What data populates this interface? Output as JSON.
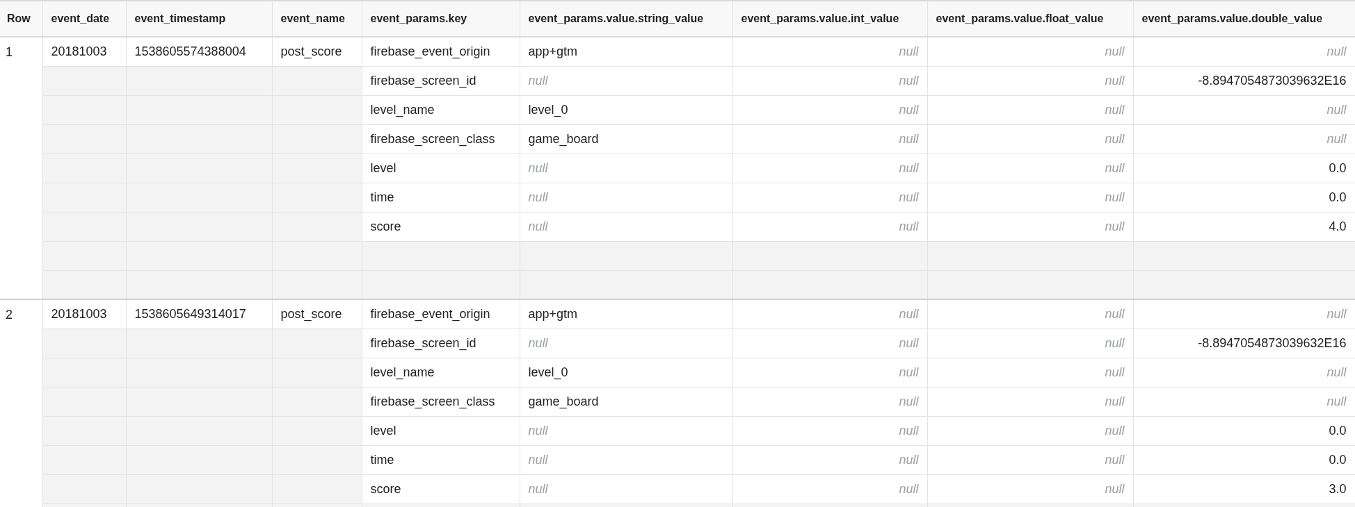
{
  "table": {
    "columns": [
      "Row",
      "event_date",
      "event_timestamp",
      "event_name",
      "event_params.key",
      "event_params.value.string_value",
      "event_params.value.int_value",
      "event_params.value.float_value",
      "event_params.value.double_value"
    ],
    "rows": [
      {
        "row": "1",
        "event_date": "20181003",
        "event_timestamp": "1538605574388004",
        "event_name": "post_score",
        "params": [
          {
            "kind": "param",
            "key": "firebase_event_origin",
            "values": [
              {
                "text": "app+gtm",
                "null": false
              },
              {
                "text": "null",
                "null": true
              },
              {
                "text": "null",
                "null": true
              },
              {
                "text": "null",
                "null": true
              }
            ]
          },
          {
            "kind": "param",
            "key": "firebase_screen_id",
            "values": [
              {
                "text": "null",
                "null": true
              },
              {
                "text": "null",
                "null": true
              },
              {
                "text": "null",
                "null": true
              },
              {
                "text": "-8.8947054873039632E16",
                "null": false
              }
            ]
          },
          {
            "kind": "param",
            "key": "level_name",
            "values": [
              {
                "text": "level_0",
                "null": false
              },
              {
                "text": "null",
                "null": true
              },
              {
                "text": "null",
                "null": true
              },
              {
                "text": "null",
                "null": true
              }
            ]
          },
          {
            "kind": "param",
            "key": "firebase_screen_class",
            "values": [
              {
                "text": "game_board",
                "null": false
              },
              {
                "text": "null",
                "null": true
              },
              {
                "text": "null",
                "null": true
              },
              {
                "text": "null",
                "null": true
              }
            ]
          },
          {
            "kind": "param",
            "key": "level",
            "values": [
              {
                "text": "null",
                "null": true
              },
              {
                "text": "null",
                "null": true
              },
              {
                "text": "null",
                "null": true
              },
              {
                "text": "0.0",
                "null": false
              }
            ]
          },
          {
            "kind": "param",
            "key": "time",
            "values": [
              {
                "text": "null",
                "null": true
              },
              {
                "text": "null",
                "null": true
              },
              {
                "text": "null",
                "null": true
              },
              {
                "text": "0.0",
                "null": false
              }
            ]
          },
          {
            "kind": "param",
            "key": "score",
            "values": [
              {
                "text": "null",
                "null": true
              },
              {
                "text": "null",
                "null": true
              },
              {
                "text": "null",
                "null": true
              },
              {
                "text": "4.0",
                "null": false
              }
            ]
          },
          {
            "kind": "empty"
          },
          {
            "kind": "empty"
          }
        ]
      },
      {
        "row": "2",
        "event_date": "20181003",
        "event_timestamp": "1538605649314017",
        "event_name": "post_score",
        "params": [
          {
            "kind": "param",
            "key": "firebase_event_origin",
            "values": [
              {
                "text": "app+gtm",
                "null": false
              },
              {
                "text": "null",
                "null": true
              },
              {
                "text": "null",
                "null": true
              },
              {
                "text": "null",
                "null": true
              }
            ]
          },
          {
            "kind": "param",
            "key": "firebase_screen_id",
            "values": [
              {
                "text": "null",
                "null": true
              },
              {
                "text": "null",
                "null": true
              },
              {
                "text": "null",
                "null": true
              },
              {
                "text": "-8.8947054873039632E16",
                "null": false
              }
            ]
          },
          {
            "kind": "param",
            "key": "level_name",
            "values": [
              {
                "text": "level_0",
                "null": false
              },
              {
                "text": "null",
                "null": true
              },
              {
                "text": "null",
                "null": true
              },
              {
                "text": "null",
                "null": true
              }
            ]
          },
          {
            "kind": "param",
            "key": "firebase_screen_class",
            "values": [
              {
                "text": "game_board",
                "null": false
              },
              {
                "text": "null",
                "null": true
              },
              {
                "text": "null",
                "null": true
              },
              {
                "text": "null",
                "null": true
              }
            ]
          },
          {
            "kind": "param",
            "key": "level",
            "values": [
              {
                "text": "null",
                "null": true
              },
              {
                "text": "null",
                "null": true
              },
              {
                "text": "null",
                "null": true
              },
              {
                "text": "0.0",
                "null": false
              }
            ]
          },
          {
            "kind": "param",
            "key": "time",
            "values": [
              {
                "text": "null",
                "null": true
              },
              {
                "text": "null",
                "null": true
              },
              {
                "text": "null",
                "null": true
              },
              {
                "text": "0.0",
                "null": false
              }
            ]
          },
          {
            "kind": "param",
            "key": "score",
            "values": [
              {
                "text": "null",
                "null": true
              },
              {
                "text": "null",
                "null": true
              },
              {
                "text": "null",
                "null": true
              },
              {
                "text": "3.0",
                "null": false
              }
            ]
          },
          {
            "kind": "empty"
          }
        ]
      }
    ]
  }
}
